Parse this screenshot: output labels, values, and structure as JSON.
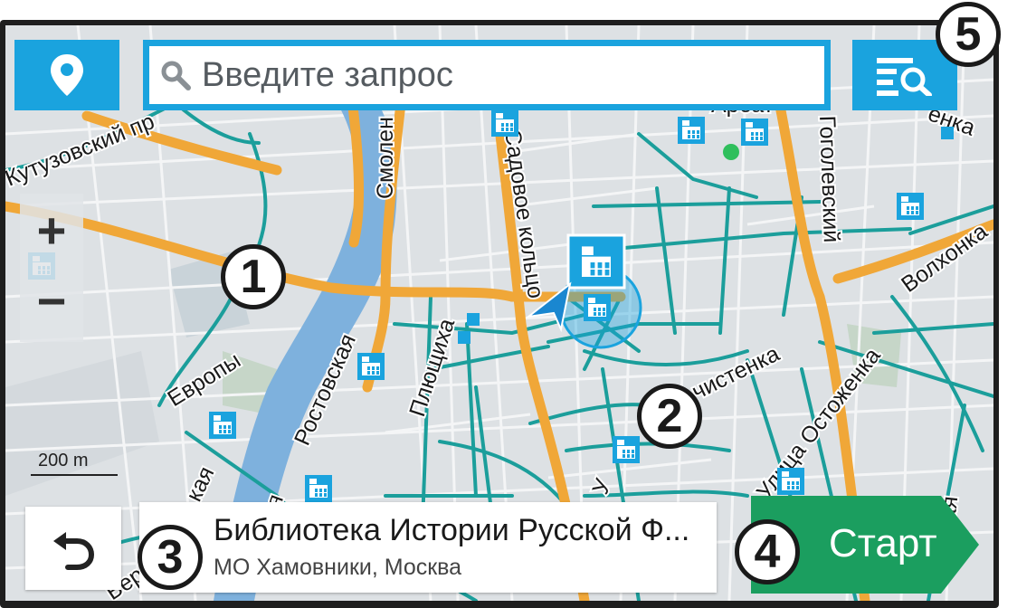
{
  "search": {
    "placeholder": "Введите запрос"
  },
  "map": {
    "street_labels": {
      "kutuzovsky": "Кутузовский пр",
      "smolenskaya": "Смолен",
      "sadovoe": "Садовое кольцо",
      "plyushchikha": "Плющиха",
      "rostovskaya": "Ростовская",
      "evropy": "Европы",
      "gogolevsky": "Гоголевский",
      "volkhonka": "Волхонка",
      "chistenka": "чистенка",
      "ostozhenka": "Улица Остоженка",
      "arbat": "Арбат",
      "enka": "енка",
      "nskaya": "енская",
      "bottom_left": "Бере",
      "bottom_kaya": "кая",
      "bottom_ya": "ая",
      "bottom_u": "У",
      "bottom_ya2": "я"
    },
    "scale": "200 m",
    "colors": {
      "major_road": "#f0a738",
      "minor_road": "#1b9e9b",
      "river": "#7eb1dd",
      "poi": "#1aa3de",
      "accent": "#1aa3de",
      "start": "#1b9e5f"
    }
  },
  "place": {
    "name": "Библиотека Истории Русской Ф...",
    "address": "МО Хамовники, Москва"
  },
  "actions": {
    "start": "Старт"
  },
  "zoom": {
    "in": "+",
    "out": "−"
  },
  "callouts": [
    "1",
    "2",
    "3",
    "4",
    "5"
  ],
  "icons": [
    "location-pin-icon",
    "search-icon",
    "filter-list-search-icon",
    "back-arrow-icon",
    "building-poi-icon",
    "vehicle-arrow-icon"
  ]
}
